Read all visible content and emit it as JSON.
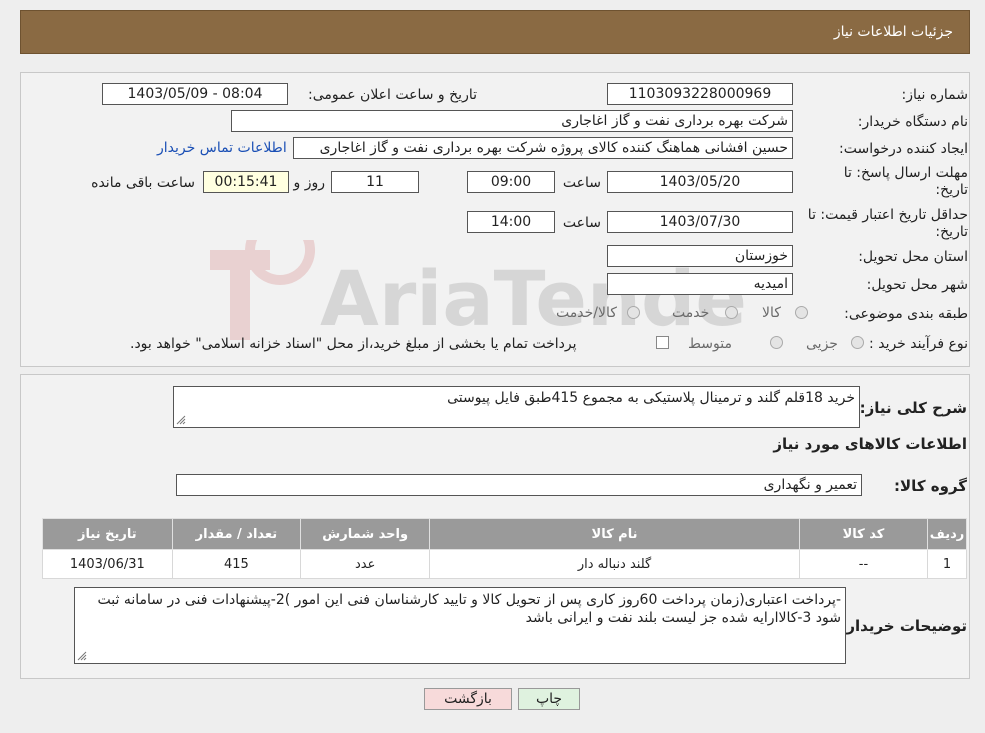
{
  "header": {
    "title": "جزئیات اطلاعات نیاز"
  },
  "form": {
    "need_number_label": "شماره نیاز:",
    "need_number": "1103093228000969",
    "announce_label": "تاریخ و ساعت اعلان عمومی:",
    "announce_value": "1403/05/09 - 08:04",
    "buyer_org_label": "نام دستگاه خریدار:",
    "buyer_org": "شرکت بهره برداری نفت و گاز اغاجاری",
    "requester_label": "ایجاد کننده درخواست:",
    "requester": "حسین افشانی هماهنگ کننده کالای پروژه شرکت بهره برداری نفت و گاز اغاجاری",
    "contact_link": "اطلاعات تماس خریدار",
    "reply_deadline_label_1": "مهلت ارسال پاسخ: تا",
    "reply_deadline_label_2": "تاریخ:",
    "reply_date": "1403/05/20",
    "time_label": "ساعت",
    "reply_time": "09:00",
    "days": "11",
    "day_label": "روز و",
    "remaining": "00:15:41",
    "remaining_label": "ساعت باقی مانده",
    "price_validity_label_1": "حداقل تاریخ اعتبار قیمت: تا",
    "price_validity_label_2": "تاریخ:",
    "validity_date": "1403/07/30",
    "validity_time_label": "ساعت",
    "validity_time": "14:00",
    "province_label": "استان محل تحویل:",
    "province": "خوزستان",
    "city_label": "شهر محل تحویل:",
    "city": "امیدیه",
    "category_label": "طبقه بندی موضوعی:",
    "category_options": [
      "کالا",
      "خدمت",
      "کالا/خدمت"
    ],
    "process_label": "نوع فرآیند خرید :",
    "process_options": [
      "جزیی",
      "متوسط"
    ],
    "process_note": "پرداخت تمام یا بخشی از مبلغ خرید،از محل \"اسناد خزانه اسلامی\" خواهد بود."
  },
  "summary": {
    "label": "شرح کلی نیاز:",
    "text": "خرید 18قلم گلند و ترمینال پلاستیکی به مجموع 415طبق فایل پیوستی",
    "goods_info_title": "اطلاعات کالاهای مورد نیاز",
    "group_label": "گروه کالا:",
    "group_value": "تعمیر و نگهداری"
  },
  "table": {
    "headers": [
      "ردیف",
      "کد کالا",
      "نام کالا",
      "واحد شمارش",
      "تعداد / مقدار",
      "تاریخ نیاز"
    ],
    "rows": [
      [
        "1",
        "--",
        "گلند دنباله دار",
        "عدد",
        "415",
        "1403/06/31"
      ]
    ]
  },
  "notes": {
    "label": "توضیحات خریدار:",
    "text": "-پرداخت اعتباری(زمان پرداخت 60روز کاری پس از تحویل کالا و تایید کارشناسان فنی این امور )2-پیشنهادات فنی در سامانه ثبت شود 3-کالاارایه شده جز لیست بلند نفت و ایرانی باشد"
  },
  "buttons": {
    "print": "چاپ",
    "back": "بازگشت"
  },
  "colors": {
    "header_bg": "#8a6a43",
    "link": "#1a4fb5",
    "back_button_bg": "#f7dada",
    "print_button_bg": "#dff2df"
  }
}
